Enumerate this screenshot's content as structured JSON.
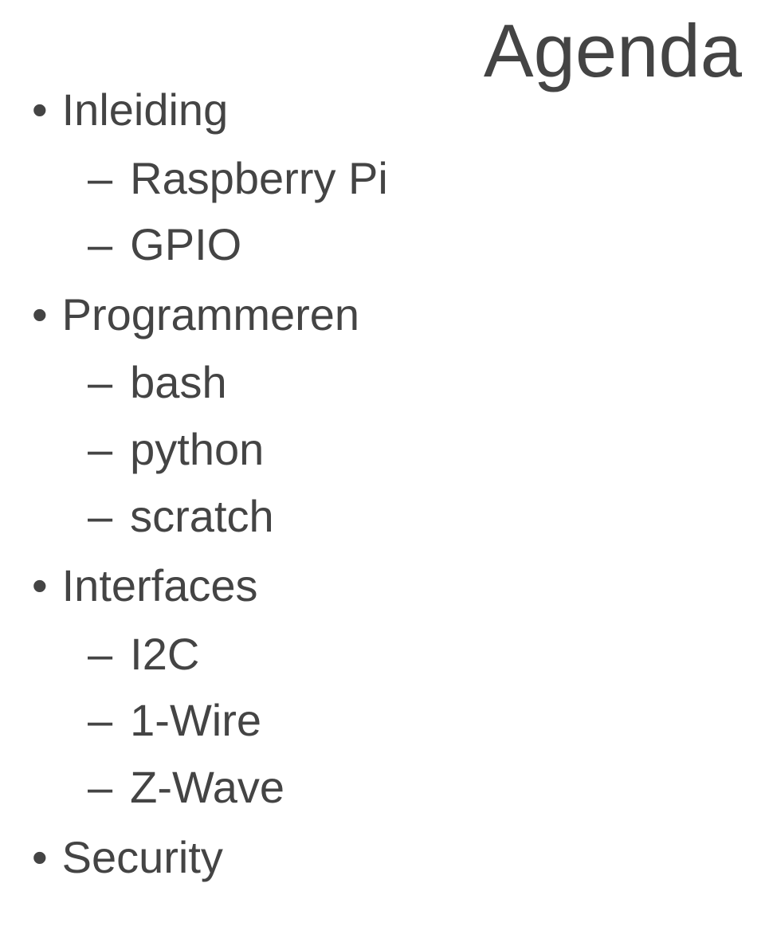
{
  "title": "Agenda",
  "sections": [
    {
      "heading": "Inleiding",
      "items": [
        "Raspberry Pi",
        "GPIO"
      ]
    },
    {
      "heading": "Programmeren",
      "items": [
        "bash",
        "python",
        "scratch"
      ]
    },
    {
      "heading": "Interfaces",
      "items": [
        "I2C",
        "1-Wire",
        "Z-Wave"
      ]
    },
    {
      "heading": "Security",
      "items": []
    }
  ]
}
